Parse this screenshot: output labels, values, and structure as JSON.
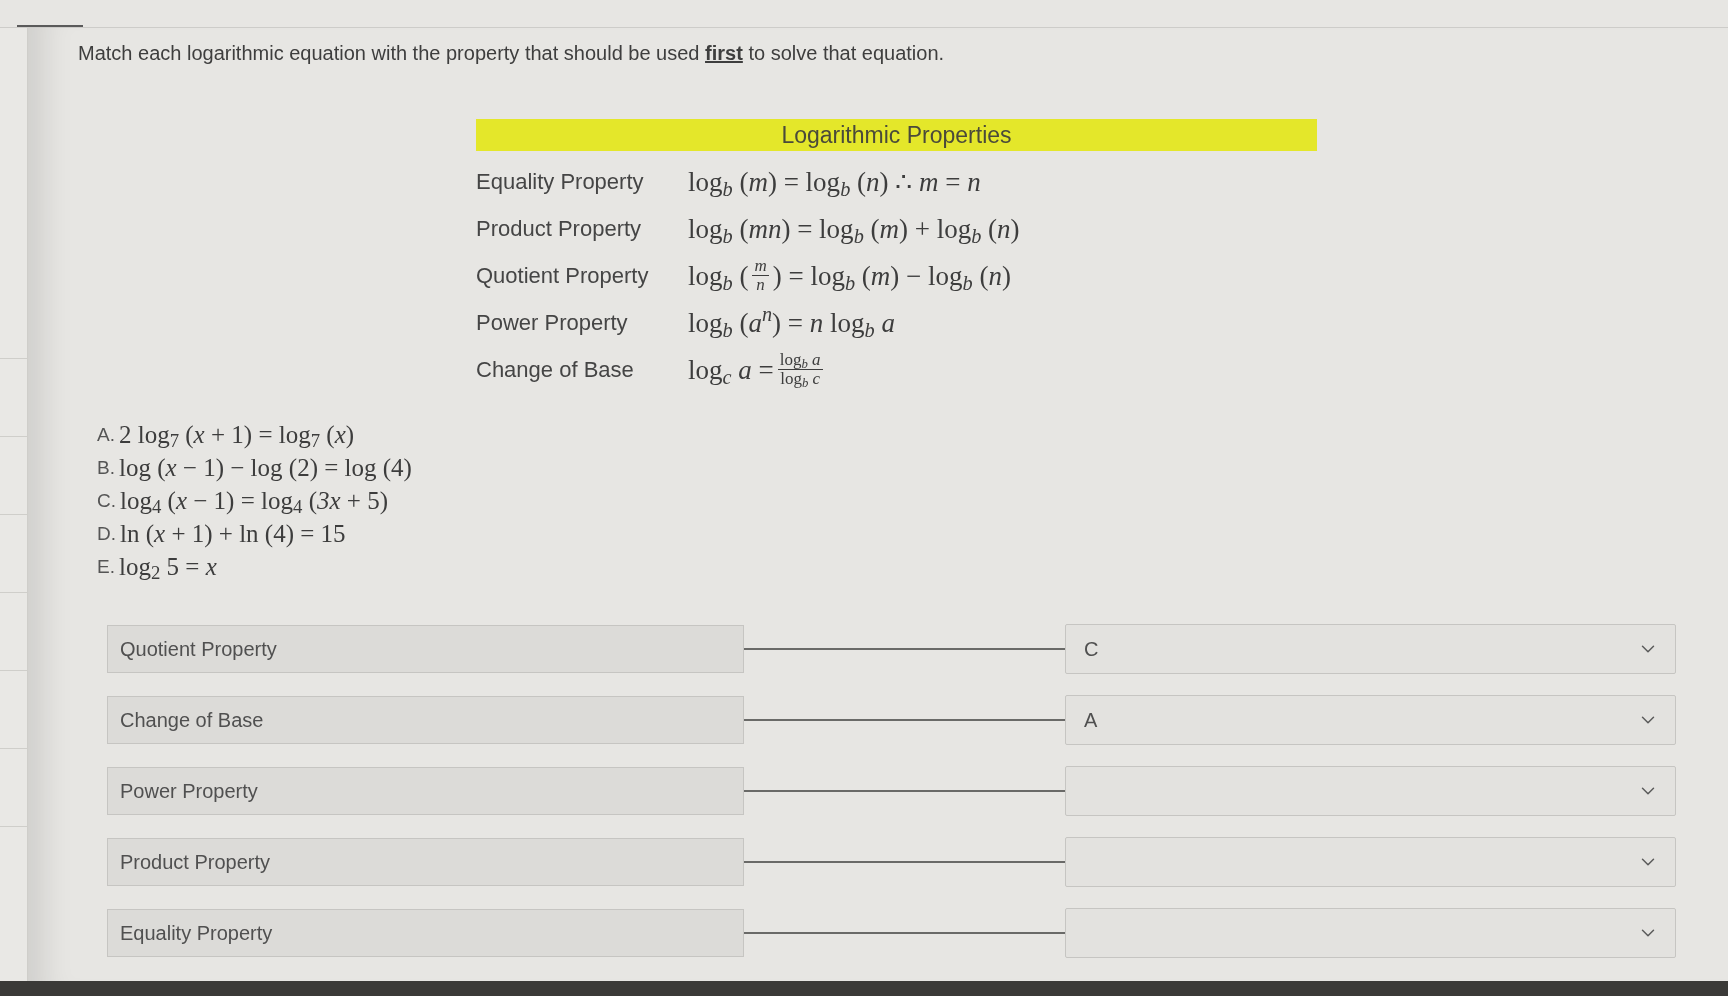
{
  "question": {
    "prompt": "Match each logarithmic equation with the property that should be used **first** to solve that equation."
  },
  "properties_table": {
    "title": "Logarithmic Properties",
    "rows": [
      {
        "name": "Equality Property",
        "formula": [
          {
            "kind": "text",
            "text": "log$_{b}$ (*m*) = log$_{b}$ (*n*) ∴ *m* = *n*"
          }
        ]
      },
      {
        "name": "Product Property",
        "formula": [
          {
            "kind": "text",
            "text": "log$_{b}$ (*mn*) = log$_{b}$ (*m*) + log$_{b}$ (*n*)"
          }
        ]
      },
      {
        "name": "Quotient Property",
        "formula": [
          {
            "kind": "text",
            "text": "log$_{b}$ ("
          },
          {
            "kind": "fraction",
            "numerator": "*m*",
            "denominator": "*n*"
          },
          {
            "kind": "text",
            "text": ") = log$_{b}$ (*m*) − log$_{b}$ (*n*)"
          }
        ]
      },
      {
        "name": "Power Property",
        "formula": [
          {
            "kind": "text",
            "text": "log$_{b}$ (*a*$^{n}$) = *n* log$_{b}$ *a*"
          }
        ]
      },
      {
        "name": "Change of Base",
        "formula": [
          {
            "kind": "text",
            "text": "log$_{c}$ *a* ="
          },
          {
            "kind": "fraction",
            "numerator": "log$_{b}$ *a*",
            "denominator": "log$_{b}$ *c*"
          }
        ]
      }
    ]
  },
  "equations": [
    {
      "letter": "A.",
      "formula": "2 log$_{7}$ (*x* + 1) = log$_{7}$ (*x*)"
    },
    {
      "letter": "B.",
      "formula": "log (*x* − 1) − log (2) = log (4)"
    },
    {
      "letter": "C.",
      "formula": "log$_{4}$ (*x* − 1) = log$_{4}$ (*3x* + 5)"
    },
    {
      "letter": "D.",
      "formula": "ln (*x* + 1) + ln (4) = 15"
    },
    {
      "letter": "E.",
      "formula": "log$_{2}$ 5 = *x*"
    }
  ],
  "matches": [
    {
      "property": "Quotient Property",
      "answer": "C"
    },
    {
      "property": "Change of Base",
      "answer": "A"
    },
    {
      "property": "Power Property"
    },
    {
      "property": "Product Property"
    },
    {
      "property": "Equality Property"
    }
  ]
}
